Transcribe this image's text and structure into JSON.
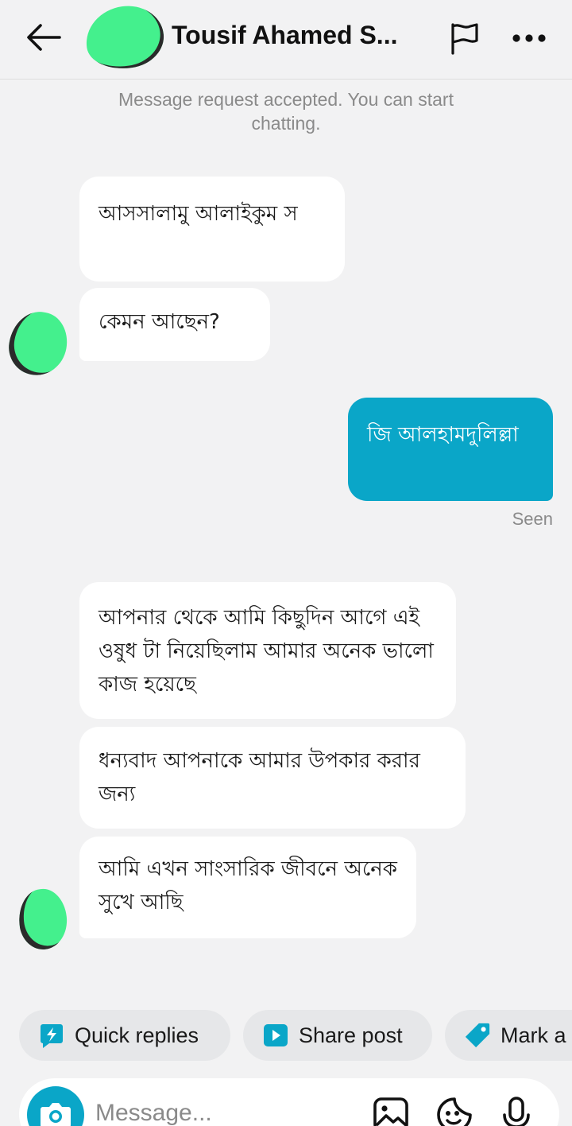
{
  "header": {
    "title": "Tousif Ahamed S...",
    "back_icon": "arrow-left-icon",
    "flag_icon": "flag-icon",
    "more_icon": "more-horizontal-icon"
  },
  "system_message": "Message request accepted. You can start chatting.",
  "messages": [
    {
      "direction": "incoming",
      "text": "আসসালামু আলাইকুম স"
    },
    {
      "direction": "incoming",
      "text": "কেমন আছেন?"
    },
    {
      "direction": "outgoing",
      "text": "জি আলহামদুলিল্লা"
    },
    {
      "direction": "incoming",
      "text": "আপনার থেকে আমি কিছুদিন আগে এই ওষুধ টা নিয়েছিলাম আমার অনেক ভালো কাজ হয়েছে"
    },
    {
      "direction": "incoming",
      "text": "ধন্যবাদ আপনাকে আমার  উপকার করার জন্য"
    },
    {
      "direction": "incoming",
      "text": "আমি এখন সাংসারিক জীবনে অনেক সুখে আছি"
    }
  ],
  "seen_label": "Seen",
  "quick_actions": [
    {
      "label": "Quick replies",
      "icon": "lightning-icon"
    },
    {
      "label": "Share post",
      "icon": "play-icon"
    },
    {
      "label": "Mark a",
      "icon": "tag-icon"
    }
  ],
  "composer": {
    "placeholder": "Message...",
    "icons": [
      "camera-icon",
      "image-icon",
      "sticker-icon",
      "microphone-icon"
    ]
  },
  "colors": {
    "background": "#f2f2f3",
    "outgoing_bubble": "#0aa6c8",
    "incoming_bubble": "#ffffff",
    "avatar_scribble": "#44f08d",
    "accent": "#0aa6c8"
  }
}
